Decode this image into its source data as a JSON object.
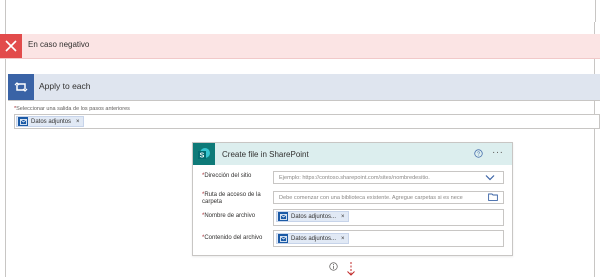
{
  "negative_branch": {
    "title": "En caso negativo",
    "icon": "close-icon",
    "color": "#e24b4b"
  },
  "apply_to_each": {
    "title": "Apply to each",
    "icon": "loop-icon",
    "select_label_required": "*",
    "select_label": "Seleccionar una salida de los pasos anteriores",
    "token": {
      "label": "Datos adjuntos",
      "remove": "×"
    }
  },
  "create_file": {
    "title": "Create file in SharePoint",
    "icon": "sharepoint-icon",
    "help_icon": "help-icon",
    "more_icon": "more-options-icon",
    "more_label": "···",
    "fields": {
      "site_address": {
        "required": "*",
        "label": "Dirección del sitio",
        "placeholder": "Ejemplo: https://contoso.sharepoint.com/sites/nombredesitio."
      },
      "folder_path": {
        "required": "*",
        "label": "Ruta de acceso de la carpeta",
        "placeholder": "Debe comenzar con una biblioteca existente. Agregue carpetas si es nece"
      },
      "file_name": {
        "required": "*",
        "label": "Nombre de archivo",
        "token_label": "Datos adjuntos...",
        "remove": "×"
      },
      "file_content": {
        "required": "*",
        "label": "Contenido del archivo",
        "token_label": "Datos adjuntos...",
        "remove": "×"
      }
    }
  },
  "colors": {
    "accent": "#3a63a6",
    "sharepoint": "#0e7a78",
    "token_bg": "#e1e9f5",
    "danger": "#e24b4b"
  }
}
